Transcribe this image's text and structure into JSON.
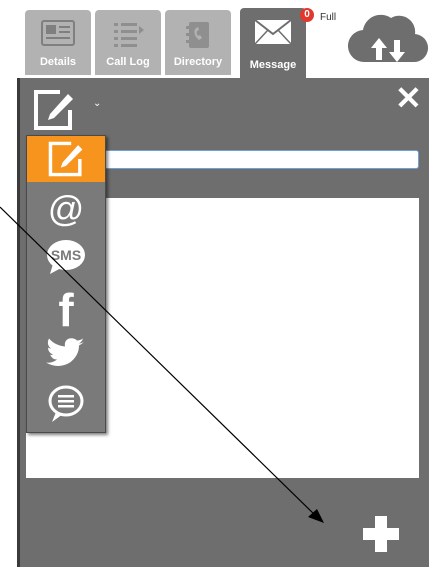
{
  "tabs": [
    {
      "label": "Details",
      "icon": "contact-card-icon"
    },
    {
      "label": "Call Log",
      "icon": "list-icon"
    },
    {
      "label": "Directory",
      "icon": "phonebook-icon"
    },
    {
      "label": "Message",
      "icon": "envelope-icon"
    }
  ],
  "message_badge": "0",
  "status": "Full",
  "cloud_icon": "cloud-sync-icon",
  "compose_icon": "compose-icon",
  "close_label": "✕",
  "dropdown_items": [
    {
      "icon": "compose-icon",
      "selected": true
    },
    {
      "icon": "email-at-icon",
      "selected": false
    },
    {
      "icon": "sms-icon",
      "label": "SMS",
      "selected": false
    },
    {
      "icon": "facebook-icon",
      "label": "f",
      "selected": false
    },
    {
      "icon": "twitter-icon",
      "selected": false
    },
    {
      "icon": "chat-bubble-icon",
      "selected": false
    }
  ],
  "colors": {
    "panel": "#6e6e6e",
    "tab_inactive": "#b2b2b2",
    "selected": "#f7941d",
    "badge": "#e2372d"
  },
  "add_icon": "plus-icon"
}
